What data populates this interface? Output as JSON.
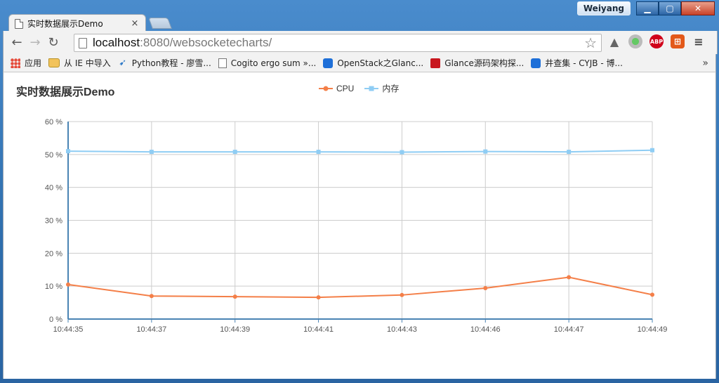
{
  "window": {
    "user": "Weiyang",
    "controls": {
      "minimize": "▁",
      "maximize": "▢",
      "close": "✕"
    }
  },
  "tabs": [
    {
      "title": "实时数据展示Demo",
      "close": "×",
      "icon": "page-icon"
    }
  ],
  "toolbar": {
    "back_icon": "←",
    "forward_icon": "→",
    "reload_icon": "↻",
    "url_host": "localhost",
    "url_rest": ":8080/websocketecharts/",
    "star_icon": "☆",
    "menu_icon": "≡"
  },
  "bookmarks": {
    "items": [
      {
        "label": "应用",
        "icon": "apps-grid-icon"
      },
      {
        "label": "从 IE 中导入",
        "icon": "folder-icon"
      },
      {
        "label": "Python教程 - 廖雪...",
        "icon": "rocket-icon"
      },
      {
        "label": "Cogito ergo sum »...",
        "icon": "document-icon"
      },
      {
        "label": "OpenStack之Glanc...",
        "icon": "blue-site-icon"
      },
      {
        "label": "Glance源码架构探...",
        "icon": "red-c-icon"
      },
      {
        "label": "井查集 - CYJB - 博...",
        "icon": "blue-site-icon"
      }
    ],
    "more": "»"
  },
  "page": {
    "title": "实时数据展示Demo"
  },
  "colors": {
    "cpu": "#f47f48",
    "mem": "#8fcdf4",
    "axis": "#4a84b4",
    "grid": "#cccccc"
  },
  "chart_data": {
    "type": "line",
    "title": "实时数据展示Demo",
    "categories": [
      "10:44:35",
      "10:44:37",
      "10:44:39",
      "10:44:41",
      "10:44:43",
      "10:44:46",
      "10:44:47",
      "10:44:49"
    ],
    "series": [
      {
        "name": "CPU",
        "values": [
          10.5,
          7.0,
          6.8,
          6.6,
          7.3,
          9.4,
          12.7,
          7.4
        ]
      },
      {
        "name": "内存",
        "values": [
          51.0,
          50.8,
          50.8,
          50.8,
          50.7,
          50.9,
          50.8,
          51.3
        ]
      }
    ],
    "ylim": [
      0,
      60
    ],
    "yticks": [
      "0 %",
      "10 %",
      "20 %",
      "30 %",
      "40 %",
      "50 %",
      "60 %"
    ],
    "grid": true,
    "legend": "top-center"
  }
}
